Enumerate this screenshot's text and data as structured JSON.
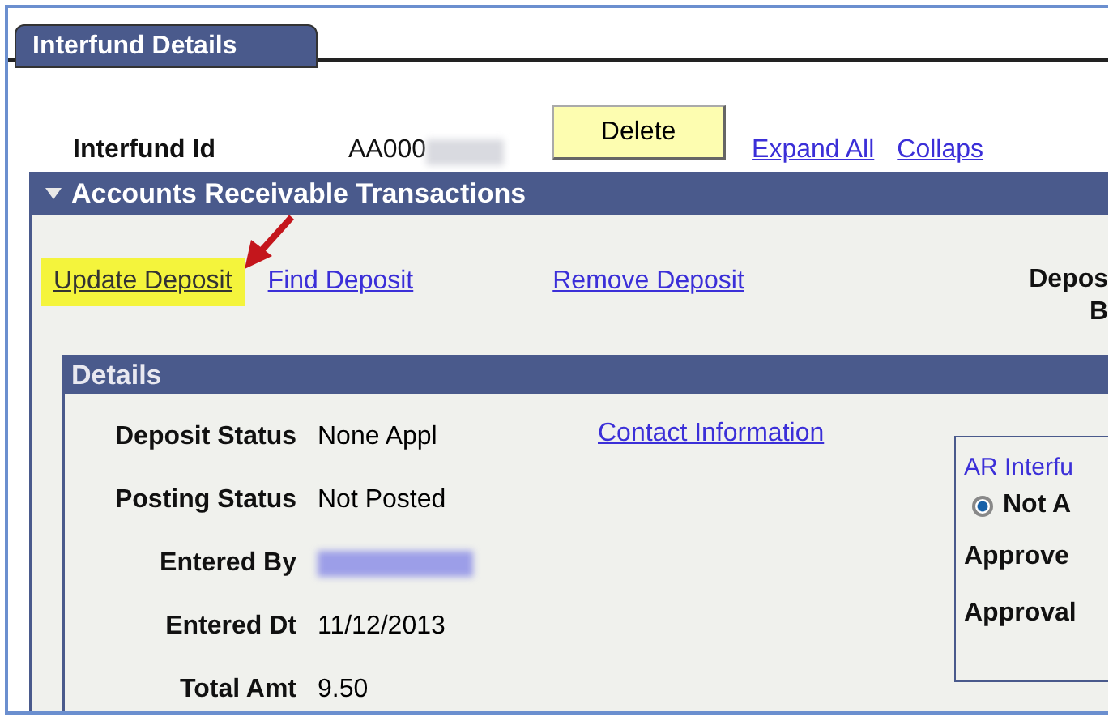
{
  "tab": {
    "label": "Interfund Details",
    "selected": true
  },
  "header": {
    "id_label": "Interfund Id",
    "id_value": "AA000",
    "id_redacted": true,
    "delete_button": "Delete",
    "links": [
      "Expand All",
      "Collaps"
    ]
  },
  "section": {
    "title": "Accounts Receivable Transactions",
    "expanded": true
  },
  "actions": [
    {
      "label": "Update Deposit",
      "highlighted": true
    },
    {
      "label": "Find Deposit",
      "highlighted": false
    },
    {
      "label": "Remove Deposit",
      "highlighted": false
    }
  ],
  "deposit_label": [
    "Depos",
    "B"
  ],
  "details": {
    "title": "Details",
    "fields": [
      {
        "kind": "text",
        "label": "Deposit Status",
        "value": "None Appl"
      },
      {
        "kind": "text",
        "label": "Posting Status",
        "value": "Not Posted"
      },
      {
        "kind": "redacted",
        "label": "Entered By"
      },
      {
        "kind": "text",
        "label": "Entered Dt",
        "value": "11/12/2013"
      },
      {
        "kind": "text",
        "label": "Total Amt",
        "value": "9.50"
      }
    ],
    "contact_link": "Contact Information",
    "ar_box": {
      "title": "AR Interfu",
      "radio": {
        "label": "Not A",
        "selected": true
      },
      "labels": [
        "Approve",
        "Approval"
      ]
    }
  },
  "annotation": {
    "arrow": true
  }
}
